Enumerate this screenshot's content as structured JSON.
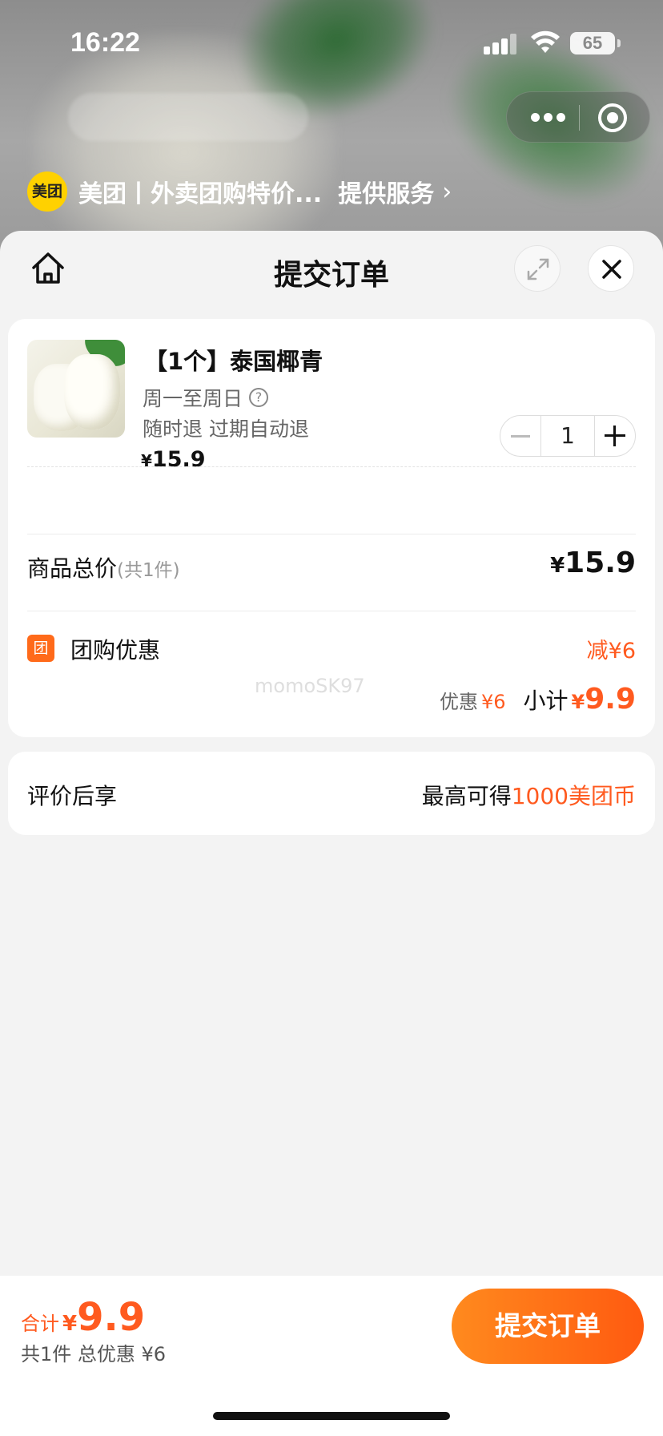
{
  "status_bar": {
    "time": "16:22",
    "battery": "65"
  },
  "provider": {
    "logo_text": "美团",
    "name": "美团丨外卖团购特价...",
    "service": "提供服务",
    "chevron": "›"
  },
  "sheet": {
    "title": "提交订单"
  },
  "product": {
    "title": "【1个】泰国椰青",
    "days": "周一至周日",
    "help_glyph": "?",
    "refund": "随时退 过期自动退",
    "price_currency": "¥",
    "price": "15.9",
    "quantity": "1"
  },
  "summary": {
    "total_label": "商品总价",
    "total_count": "(共1件)",
    "total_currency": "¥",
    "total_value": "15.9",
    "group_icon": "团",
    "group_label": "团购优惠",
    "group_value": "减¥6",
    "watermark": "momoSK97",
    "discount_label": "优惠",
    "discount_value": "¥6",
    "subtotal_label": "小计",
    "subtotal_currency": "¥",
    "subtotal_value": "9.9"
  },
  "review": {
    "label": "评价后享",
    "prefix": "最高可得",
    "coins": "1000美团币"
  },
  "footer": {
    "total_label": "合计",
    "total_currency": "¥",
    "total_value": "9.9",
    "total_sub": "共1件 总优惠 ¥6",
    "submit_label": "提交订单"
  },
  "colors": {
    "accent": "#ff5a1f",
    "brand_yellow": "#ffd100",
    "background": "#f3f3f3"
  }
}
